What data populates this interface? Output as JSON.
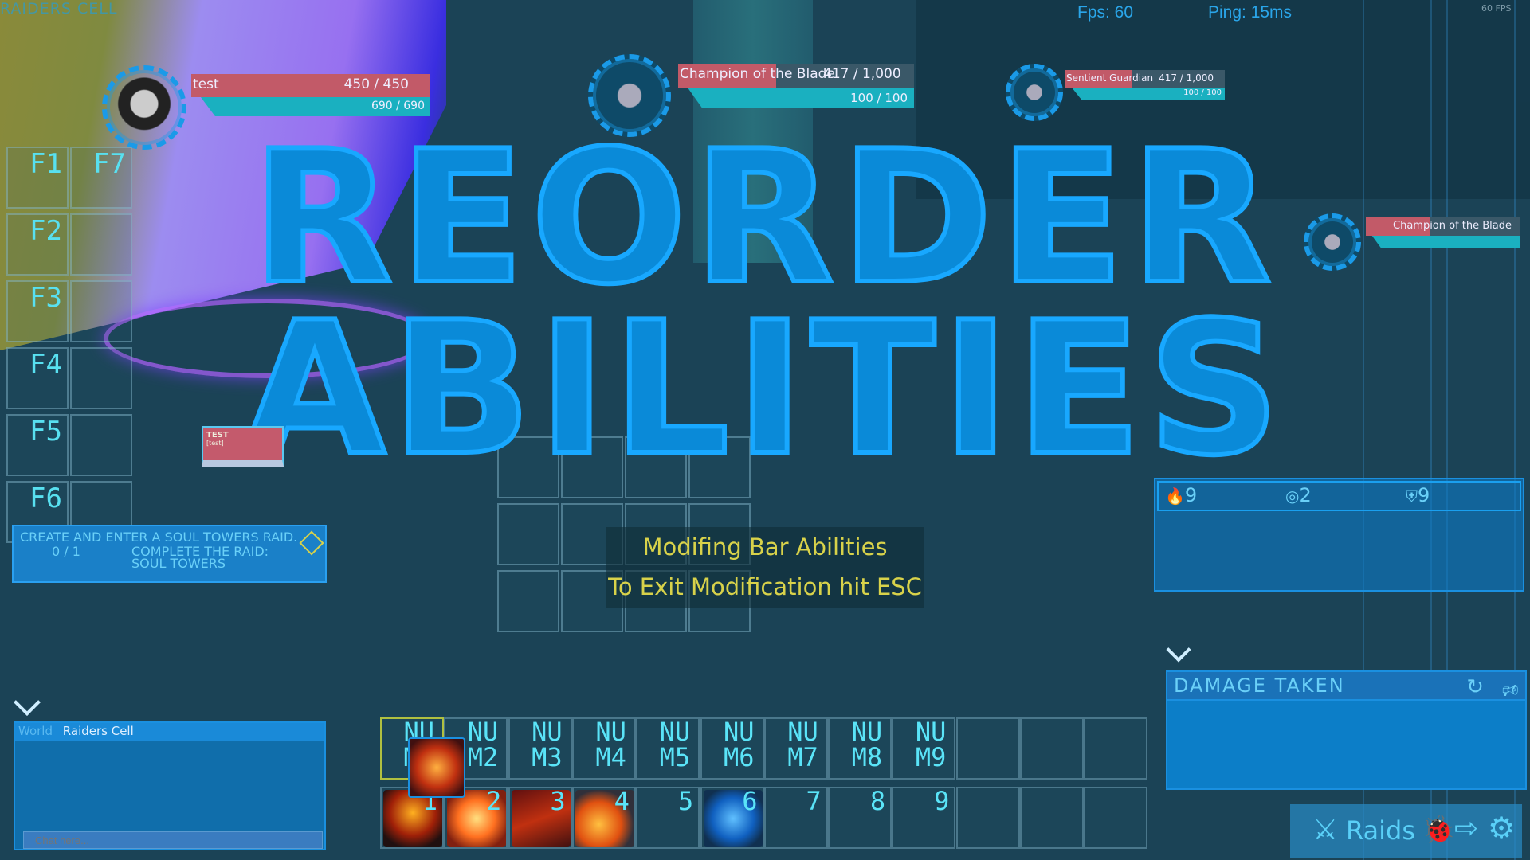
{
  "hud": {
    "zone_label": "RAIDERS CELL",
    "fps": "Fps: 60",
    "ping": "Ping: 15ms",
    "engine_fps": "60 FPS"
  },
  "player": {
    "name": "test",
    "health": "450 / 450",
    "health_fraction": 1.0,
    "mana": "690 / 690",
    "mana_fraction": 1.0
  },
  "target": {
    "name": "Champion of the Blade",
    "health": "417 / 1,000",
    "health_fraction": 0.417,
    "mana": "100 / 100"
  },
  "party": [
    {
      "name": "Sentient Guardian",
      "health": "417 / 1,000",
      "health_fraction": 0.417,
      "mana": "100 / 100"
    },
    {
      "name": "Champion of the Blade",
      "health_fraction": 0.417
    }
  ],
  "function_bar": {
    "keys": [
      "F1",
      "F2",
      "F3",
      "F4",
      "F5",
      "F6",
      "F7"
    ]
  },
  "overlay_title": {
    "line1": "REORDER",
    "line2": "ABILITIES"
  },
  "modify_message": {
    "line1": "Modifing Bar Abilities",
    "line2": "To Exit Modification hit ESC"
  },
  "test_nameplate": {
    "title": "TEST",
    "subtitle": "[test]"
  },
  "quest": {
    "title": "CREATE AND ENTER A SOUL TOWERS RAID.",
    "progress": "0 / 1",
    "objective": "COMPLETE THE RAID: SOUL TOWERS"
  },
  "chat": {
    "channel": "World",
    "room": "Raiders Cell",
    "placeholder": "Chat here..."
  },
  "numpad_bar": {
    "keys": [
      "NU M1",
      "NU M2",
      "NU M3",
      "NU M4",
      "NU M5",
      "NU M6",
      "NU M7",
      "NU M8",
      "NU M9",
      "",
      "",
      ""
    ]
  },
  "main_bar": {
    "keys": [
      "1",
      "2",
      "3",
      "4",
      "5",
      "6",
      "7",
      "8",
      "9",
      "",
      "",
      ""
    ],
    "icons": [
      "fire-demon",
      "fire-burst",
      "lightning",
      "fireball",
      "",
      "blue-orbs",
      "",
      "",
      "",
      "",
      "",
      ""
    ]
  },
  "stats": [
    {
      "icon": "fire-icon",
      "value": "9"
    },
    {
      "icon": "aperture-icon",
      "value": "2"
    },
    {
      "icon": "shield-icon",
      "value": "9"
    }
  ],
  "damage_panel": {
    "title": "DAMAGE TAKEN"
  },
  "menu": {
    "raids_label": "Raids"
  },
  "colors": {
    "accent": "#1aa0f0",
    "health": "#c25a68",
    "mana": "#1ab0c0",
    "message": "#d8d24a"
  }
}
